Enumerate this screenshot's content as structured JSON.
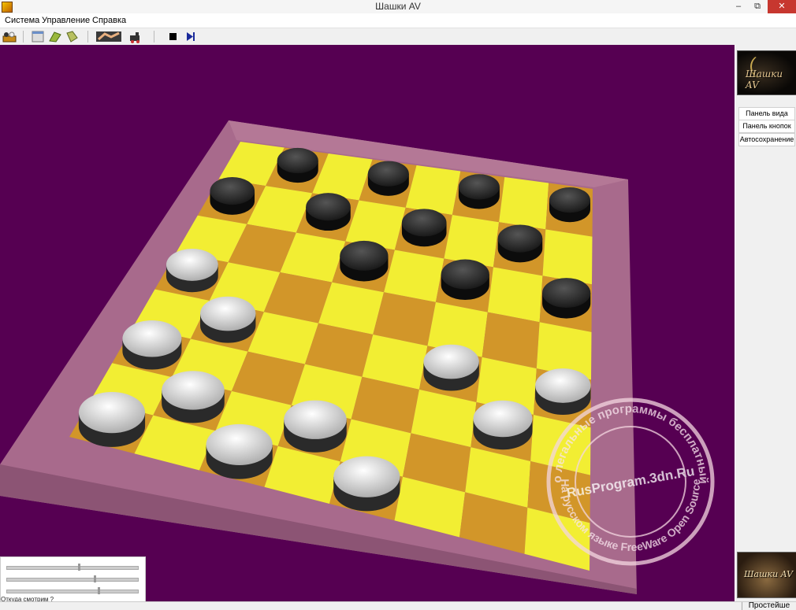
{
  "window": {
    "title": "Шашки AV"
  },
  "menu": {
    "items": [
      "Система",
      "Управление",
      "Справка"
    ]
  },
  "toolbar": {
    "icons": [
      "new-game-icon",
      "board-icon",
      "load-icon",
      "save-icon",
      "handshake-icon",
      "engine-icon",
      "stop-icon",
      "play-icon"
    ]
  },
  "logo": {
    "text": "Шашки AV"
  },
  "side_panel": {
    "buttons": [
      "Панель вида",
      "Панель кнопок",
      "Автосохранение"
    ]
  },
  "logo_bottom": {
    "text": "Шашки AV"
  },
  "view_panel": {
    "caption": "Откуда смотрим ?",
    "slider_values": [
      0.56,
      0.69,
      0.72
    ]
  },
  "status": {
    "level": "Простейше"
  },
  "watermark": {
    "site": "RusProgram.3dn.Ru",
    "ring_top": "Только легальные программы бесплатный софт",
    "ring_bottom": "На русском языке FreeWare Open Source"
  },
  "board": {
    "size": 8,
    "black_pieces": [
      [
        0,
        1
      ],
      [
        0,
        3
      ],
      [
        0,
        5
      ],
      [
        0,
        7
      ],
      [
        1,
        0
      ],
      [
        1,
        2
      ],
      [
        1,
        4
      ],
      [
        1,
        6
      ],
      [
        2,
        3
      ],
      [
        2,
        5
      ],
      [
        2,
        7
      ]
    ],
    "white_pieces": [
      [
        3,
        0
      ],
      [
        4,
        1
      ],
      [
        4,
        5
      ],
      [
        4,
        7
      ],
      [
        5,
        0
      ],
      [
        5,
        6
      ],
      [
        6,
        1
      ],
      [
        6,
        3
      ],
      [
        7,
        0
      ],
      [
        7,
        2
      ],
      [
        7,
        4
      ]
    ],
    "colors": {
      "light": "#f2ee33",
      "dark": "#d29629",
      "frame": "#a86a8c",
      "background": "#560052"
    }
  }
}
